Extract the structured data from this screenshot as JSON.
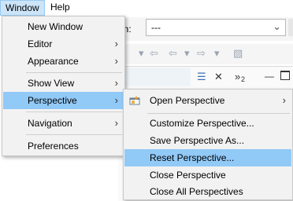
{
  "menubar": {
    "items": [
      "Window",
      "Help"
    ]
  },
  "background": {
    "combo_label": "on:",
    "combo_value": "---",
    "panel_count": "2"
  },
  "window_menu": {
    "items": [
      {
        "label": "New Window",
        "has_submenu": false
      },
      {
        "label": "Editor",
        "has_submenu": true
      },
      {
        "label": "Appearance",
        "has_submenu": true
      },
      {
        "label": "Show View",
        "has_submenu": true
      },
      {
        "label": "Perspective",
        "has_submenu": true,
        "highlighted": true
      },
      {
        "label": "Navigation",
        "has_submenu": true
      },
      {
        "label": "Preferences",
        "has_submenu": false
      }
    ]
  },
  "perspective_menu": {
    "items": [
      {
        "label": "Open Perspective",
        "has_submenu": true,
        "icon": "open-perspective-icon"
      },
      {
        "label": "Customize Perspective...",
        "has_submenu": false
      },
      {
        "label": "Save Perspective As...",
        "has_submenu": false
      },
      {
        "label": "Reset Perspective...",
        "has_submenu": false,
        "highlighted": true
      },
      {
        "label": "Close Perspective",
        "has_submenu": false
      },
      {
        "label": "Close All Perspectives",
        "has_submenu": false
      }
    ]
  },
  "colors": {
    "highlight": "#91c9f7",
    "menubar_active": "#cce4f7",
    "menu_bg": "#f2f2f2"
  }
}
